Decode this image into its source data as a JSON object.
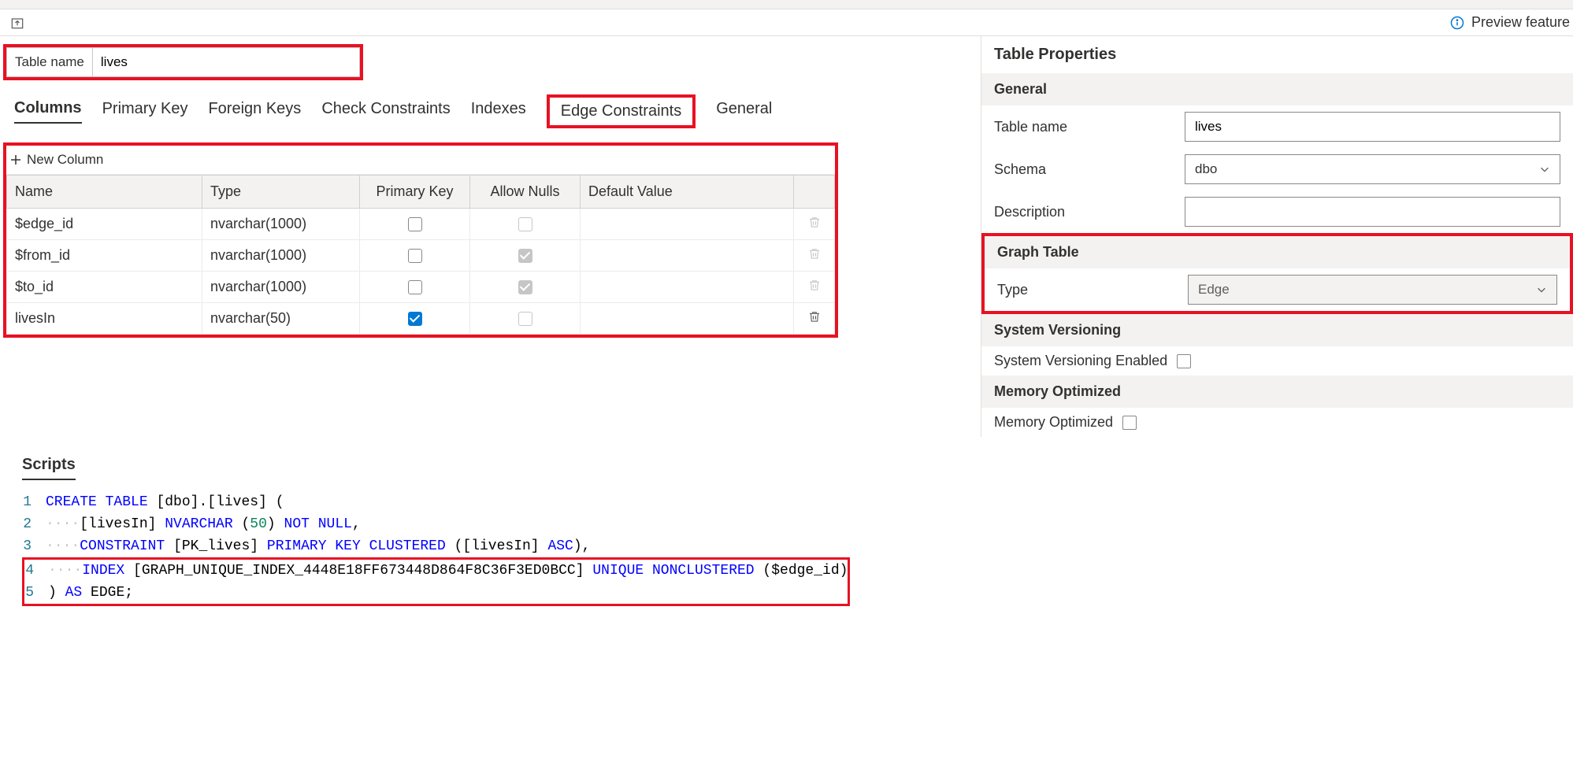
{
  "preview_label": "Preview feature",
  "table_name_label": "Table name",
  "table_name_value": "lives",
  "tabs": {
    "columns": "Columns",
    "primary_key": "Primary Key",
    "foreign_keys": "Foreign Keys",
    "check_constraints": "Check Constraints",
    "indexes": "Indexes",
    "edge_constraints": "Edge Constraints",
    "general": "General"
  },
  "new_column_label": "New Column",
  "headers": {
    "name": "Name",
    "type": "Type",
    "primary_key": "Primary Key",
    "allow_nulls": "Allow Nulls",
    "default_value": "Default Value"
  },
  "rows": [
    {
      "name": "$edge_id",
      "type": "nvarchar(1000)",
      "pk": false,
      "nulls": "disabled",
      "default": "",
      "trash": "disabled"
    },
    {
      "name": "$from_id",
      "type": "nvarchar(1000)",
      "pk": false,
      "nulls": "checked-gray",
      "default": "",
      "trash": "disabled"
    },
    {
      "name": "$to_id",
      "type": "nvarchar(1000)",
      "pk": false,
      "nulls": "checked-gray",
      "default": "",
      "trash": "disabled"
    },
    {
      "name": "livesIn",
      "type": "nvarchar(50)",
      "pk": true,
      "nulls": "disabled",
      "default": "",
      "trash": "enabled"
    }
  ],
  "properties": {
    "title": "Table Properties",
    "general_head": "General",
    "table_name_label": "Table name",
    "table_name_value": "lives",
    "schema_label": "Schema",
    "schema_value": "dbo",
    "description_label": "Description",
    "description_value": "",
    "graph_head": "Graph Table",
    "type_label": "Type",
    "type_value": "Edge",
    "sysver_head": "System Versioning",
    "sysver_label": "System Versioning Enabled",
    "memopt_head": "Memory Optimized",
    "memopt_label": "Memory Optimized"
  },
  "scripts": {
    "title": "Scripts",
    "lines": [
      {
        "n": "1",
        "tokens": [
          [
            "kw",
            "CREATE"
          ],
          [
            "sp",
            " "
          ],
          [
            "kw",
            "TABLE"
          ],
          [
            "sp",
            " "
          ],
          [
            "id",
            "[dbo].[lives]"
          ],
          [
            "sp",
            " "
          ],
          [
            "id",
            "("
          ]
        ]
      },
      {
        "n": "2",
        "tokens": [
          [
            "dots",
            "····"
          ],
          [
            "id",
            "[livesIn]"
          ],
          [
            "sp",
            " "
          ],
          [
            "kw",
            "NVARCHAR"
          ],
          [
            "sp",
            " "
          ],
          [
            "id",
            "("
          ],
          [
            "num",
            "50"
          ],
          [
            "id",
            ")"
          ],
          [
            "sp",
            " "
          ],
          [
            "kw",
            "NOT"
          ],
          [
            "sp",
            " "
          ],
          [
            "kw",
            "NULL"
          ],
          [
            "id",
            ","
          ]
        ]
      },
      {
        "n": "3",
        "tokens": [
          [
            "dots",
            "····"
          ],
          [
            "kw",
            "CONSTRAINT"
          ],
          [
            "sp",
            " "
          ],
          [
            "id",
            "[PK_lives]"
          ],
          [
            "sp",
            " "
          ],
          [
            "kw",
            "PRIMARY"
          ],
          [
            "sp",
            " "
          ],
          [
            "kw",
            "KEY"
          ],
          [
            "sp",
            " "
          ],
          [
            "kw",
            "CLUSTERED"
          ],
          [
            "sp",
            " "
          ],
          [
            "id",
            "([livesIn]"
          ],
          [
            "sp",
            " "
          ],
          [
            "kw",
            "ASC"
          ],
          [
            "id",
            "),"
          ]
        ]
      },
      {
        "n": "4",
        "tokens": [
          [
            "dots",
            "····"
          ],
          [
            "kw",
            "INDEX"
          ],
          [
            "sp",
            " "
          ],
          [
            "id",
            "[GRAPH_UNIQUE_INDEX_4448E18FF673448D864F8C36F3ED0BCC]"
          ],
          [
            "sp",
            " "
          ],
          [
            "kw",
            "UNIQUE"
          ],
          [
            "sp",
            " "
          ],
          [
            "kw",
            "NONCLUSTERED"
          ],
          [
            "sp",
            " "
          ],
          [
            "id",
            "($edge_id)"
          ]
        ]
      },
      {
        "n": "5",
        "tokens": [
          [
            "id",
            ")"
          ],
          [
            "sp",
            " "
          ],
          [
            "kw",
            "AS"
          ],
          [
            "sp",
            " "
          ],
          [
            "id",
            "EDGE;"
          ]
        ]
      }
    ]
  }
}
